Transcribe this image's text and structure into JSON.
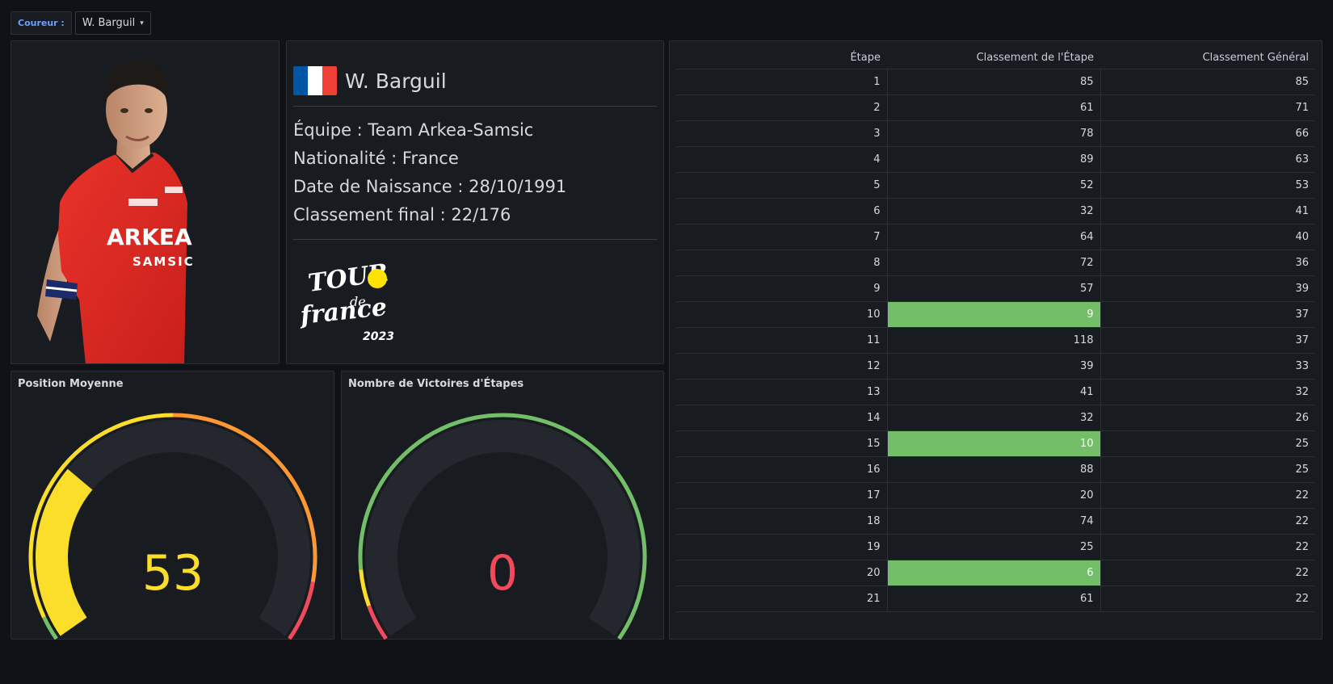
{
  "variable": {
    "label": "Coureur :",
    "value": "W. Barguil"
  },
  "rider": {
    "name": "W. Barguil",
    "team_line": "Équipe : Team Arkea-Samsic",
    "nationality_line": "Nationalité : France",
    "birth_line": "Date de Naissance : 28/10/1991",
    "final_line": "Classement final : 22/176",
    "flag_colors": [
      "#0055a4",
      "#ffffff",
      "#ef4135"
    ],
    "jersey_text_1": "ARKEA",
    "jersey_text_2": "SAMSIC"
  },
  "logo": {
    "line1": "TOUR",
    "line2": "de",
    "line3": "france",
    "year": "2023"
  },
  "gauges": {
    "average": {
      "title": "Position Moyenne",
      "value": "53",
      "min": 0,
      "max": 176,
      "fraction": 0.3,
      "color": "#fade2a"
    },
    "wins": {
      "title": "Nombre de Victoires d'Étapes",
      "value": "0",
      "fraction": 0,
      "color": "#f2495c"
    }
  },
  "table": {
    "headers": [
      "Étape",
      "Classement de l'Étape",
      "Classement Général"
    ],
    "highlight_color": "#73bf69",
    "rows": [
      {
        "stage": "1",
        "stage_rank": "85",
        "general": "85",
        "hl": false
      },
      {
        "stage": "2",
        "stage_rank": "61",
        "general": "71",
        "hl": false
      },
      {
        "stage": "3",
        "stage_rank": "78",
        "general": "66",
        "hl": false
      },
      {
        "stage": "4",
        "stage_rank": "89",
        "general": "63",
        "hl": false
      },
      {
        "stage": "5",
        "stage_rank": "52",
        "general": "53",
        "hl": false
      },
      {
        "stage": "6",
        "stage_rank": "32",
        "general": "41",
        "hl": false
      },
      {
        "stage": "7",
        "stage_rank": "64",
        "general": "40",
        "hl": false
      },
      {
        "stage": "8",
        "stage_rank": "72",
        "general": "36",
        "hl": false
      },
      {
        "stage": "9",
        "stage_rank": "57",
        "general": "39",
        "hl": false
      },
      {
        "stage": "10",
        "stage_rank": "9",
        "general": "37",
        "hl": true
      },
      {
        "stage": "11",
        "stage_rank": "118",
        "general": "37",
        "hl": false
      },
      {
        "stage": "12",
        "stage_rank": "39",
        "general": "33",
        "hl": false
      },
      {
        "stage": "13",
        "stage_rank": "41",
        "general": "32",
        "hl": false
      },
      {
        "stage": "14",
        "stage_rank": "32",
        "general": "26",
        "hl": false
      },
      {
        "stage": "15",
        "stage_rank": "10",
        "general": "25",
        "hl": true
      },
      {
        "stage": "16",
        "stage_rank": "88",
        "general": "25",
        "hl": false
      },
      {
        "stage": "17",
        "stage_rank": "20",
        "general": "22",
        "hl": false
      },
      {
        "stage": "18",
        "stage_rank": "74",
        "general": "22",
        "hl": false
      },
      {
        "stage": "19",
        "stage_rank": "25",
        "general": "22",
        "hl": false
      },
      {
        "stage": "20",
        "stage_rank": "6",
        "general": "22",
        "hl": true
      },
      {
        "stage": "21",
        "stage_rank": "61",
        "general": "22",
        "hl": false
      }
    ]
  }
}
